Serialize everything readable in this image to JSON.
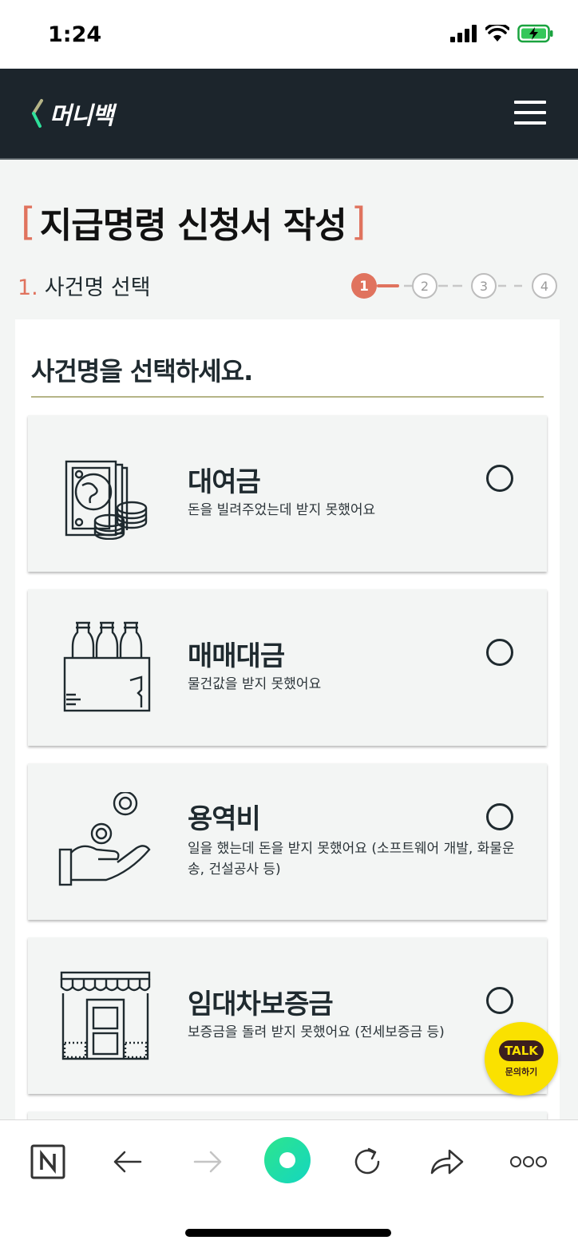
{
  "status_bar": {
    "time": "1:24"
  },
  "header": {
    "logo_text": "머니백"
  },
  "page": {
    "title": "지급명령 신청서 작성",
    "bracket_open": "[",
    "bracket_close": "]"
  },
  "step": {
    "number": "1.",
    "label": "사건명 선택",
    "steps": [
      "1",
      "2",
      "3",
      "4"
    ],
    "current": 1
  },
  "panel": {
    "title": "사건명을 선택하세요.",
    "options": [
      {
        "title": "대여금",
        "desc": "돈을 빌려주었는데 받지 못했어요",
        "icon": "money-coins-icon"
      },
      {
        "title": "매매대금",
        "desc": "물건값을 받지 못했어요",
        "icon": "bottles-box-icon"
      },
      {
        "title": "용역비",
        "desc": "일을 했는데 돈을 받지 못했어요 (소프트웨어 개발, 화물운송, 건설공사 등)",
        "icon": "hand-coin-icon"
      },
      {
        "title": "임대차보증금",
        "desc": "보증금을 돌려 받지 못했어요 (전세보증금 등)",
        "icon": "storefront-icon"
      }
    ]
  },
  "kakao": {
    "bubble": "TALK",
    "label": "문의하기"
  },
  "colors": {
    "accent": "#e0735e",
    "header_bg": "#1c252c",
    "kakao": "#fae100",
    "go_green": "#1de0a0"
  }
}
